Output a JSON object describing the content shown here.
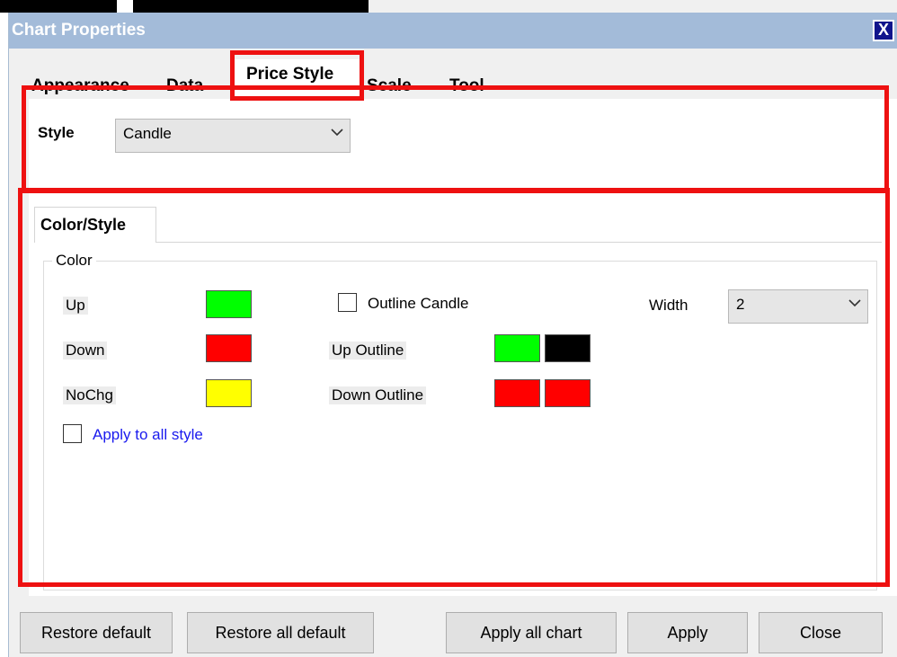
{
  "window": {
    "title": "Chart Properties",
    "close_glyph": "X"
  },
  "tabs": [
    {
      "label": "Appearance"
    },
    {
      "label": "Data"
    },
    {
      "label": "Price Style"
    },
    {
      "label": "Scale"
    },
    {
      "label": "Tool"
    }
  ],
  "style_section": {
    "label": "Style",
    "selected": "Candle"
  },
  "subtab": {
    "label": "Color/Style"
  },
  "color_group": {
    "legend": "Color",
    "up_label": "Up",
    "down_label": "Down",
    "nochg_label": "NoChg",
    "up_color": "#00ff00",
    "down_color": "#ff0000",
    "nochg_color": "#ffff00",
    "outline_candle_label": "Outline Candle",
    "outline_candle_checked": false,
    "up_outline_label": "Up Outline",
    "up_outline_colors": [
      "#00ff00",
      "#000000"
    ],
    "down_outline_label": "Down Outline",
    "down_outline_colors": [
      "#ff0000",
      "#ff0000"
    ],
    "width_label": "Width",
    "width_value": "2",
    "apply_all_style_label": "Apply to all style",
    "apply_all_style_checked": false
  },
  "buttons": {
    "restore_default": "Restore default",
    "restore_all_default": "Restore all default",
    "apply_all_chart": "Apply all chart",
    "apply": "Apply",
    "close": "Close"
  },
  "colors": {
    "title_bar": "#a3bbd9",
    "highlight": "#ee1111",
    "link": "#0000ff"
  }
}
